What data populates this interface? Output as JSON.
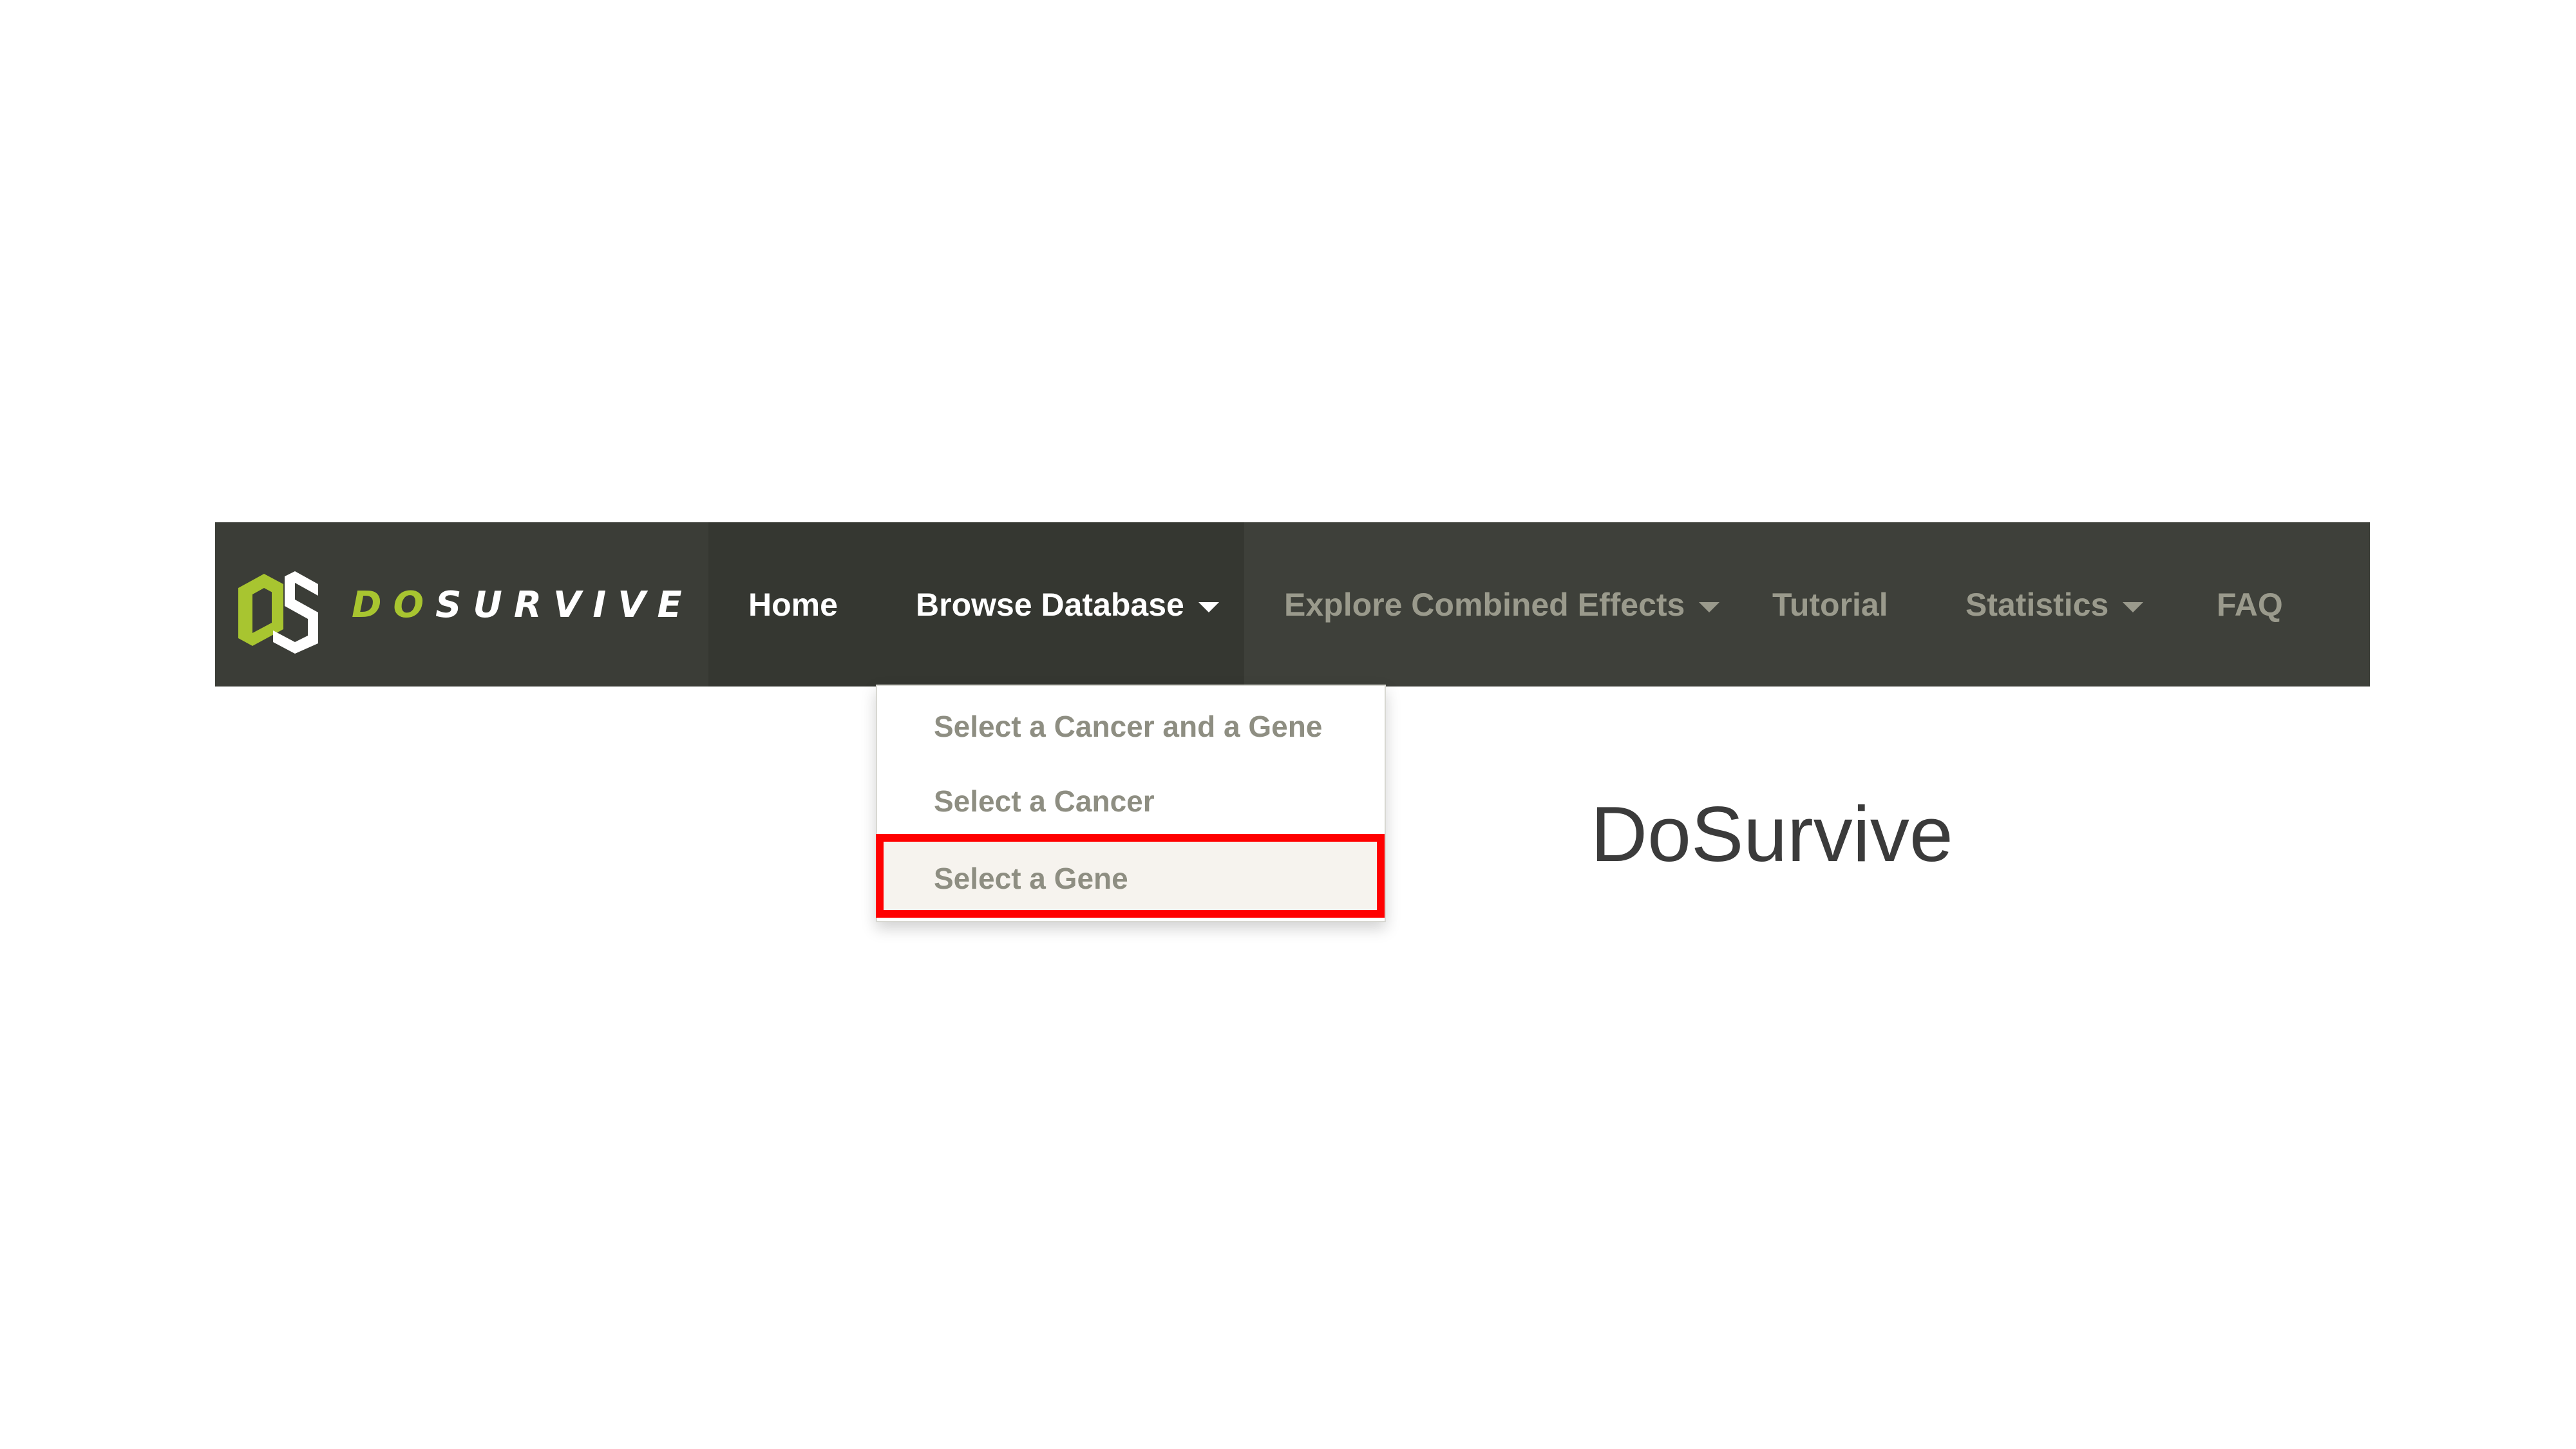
{
  "brand": {
    "logo_text_accent": "DO",
    "logo_text_rest": "SURVIVE",
    "colors": {
      "accent": "#a8c530",
      "text": "#ffffff"
    }
  },
  "nav": {
    "home": "Home",
    "browse_database": "Browse Database",
    "explore_combined_effects": "Explore Combined Effects",
    "tutorial": "Tutorial",
    "statistics": "Statistics",
    "faq": "FAQ"
  },
  "dropdown": {
    "items": [
      {
        "label": "Select a Cancer and a Gene"
      },
      {
        "label": "Select a Cancer"
      },
      {
        "label": "Select a Gene"
      }
    ],
    "highlighted_item": "Select a Gene",
    "highlight_color": "#ff0000"
  },
  "main": {
    "title": "DoSurvive"
  },
  "colors": {
    "navbar_bg": "#3e403a",
    "muted_nav_text": "#9a9a8c",
    "dropdown_text": "#8e8e82"
  }
}
